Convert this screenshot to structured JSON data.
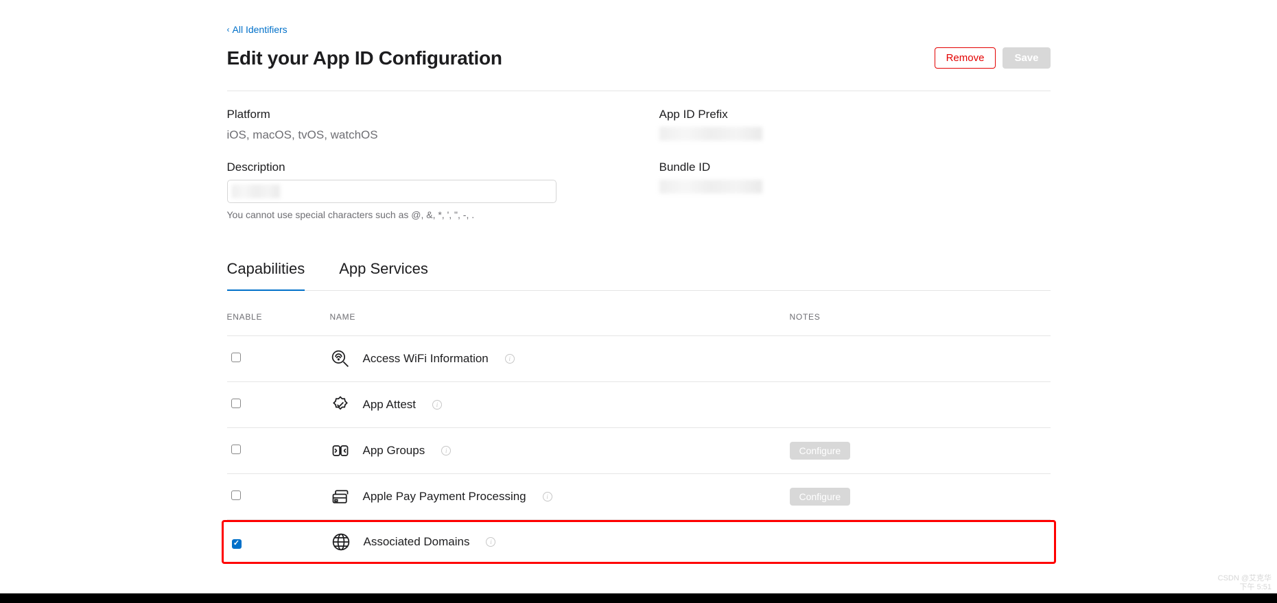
{
  "nav": {
    "back": "All Identifiers"
  },
  "header": {
    "title": "Edit your App ID Configuration",
    "remove": "Remove",
    "save": "Save"
  },
  "info": {
    "platform_label": "Platform",
    "platform_value": "iOS, macOS, tvOS, watchOS",
    "description_label": "Description",
    "description_hint": "You cannot use special characters such as @, &, *, ', \", -, .",
    "prefix_label": "App ID Prefix",
    "bundle_label": "Bundle ID"
  },
  "tabs": {
    "capabilities": "Capabilities",
    "app_services": "App Services"
  },
  "columns": {
    "enable": "ENABLE",
    "name": "NAME",
    "notes": "NOTES"
  },
  "capabilities": [
    {
      "id": "access-wifi-information",
      "label": "Access WiFi Information",
      "checked": false,
      "info": true,
      "notes": null,
      "highlight": false
    },
    {
      "id": "app-attest",
      "label": "App Attest",
      "checked": false,
      "info": true,
      "notes": null,
      "highlight": false
    },
    {
      "id": "app-groups",
      "label": "App Groups",
      "checked": false,
      "info": true,
      "notes": "Configure",
      "highlight": false
    },
    {
      "id": "apple-pay",
      "label": "Apple Pay Payment Processing",
      "checked": false,
      "info": true,
      "notes": "Configure",
      "highlight": false
    },
    {
      "id": "associated-domains",
      "label": "Associated Domains",
      "checked": true,
      "info": true,
      "notes": null,
      "highlight": true
    }
  ],
  "watermark": {
    "line1": "CSDN @艾克华",
    "line2": "下午 5:51"
  }
}
